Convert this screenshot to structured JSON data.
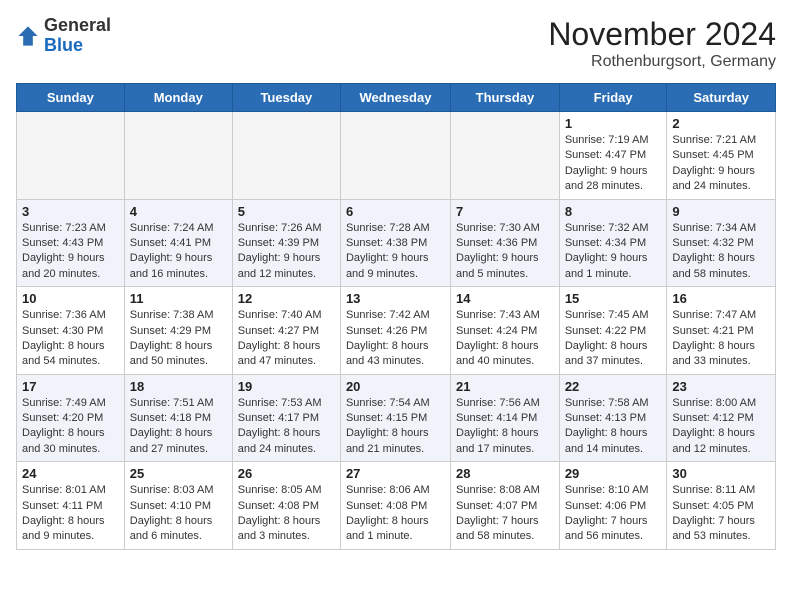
{
  "logo": {
    "general": "General",
    "blue": "Blue"
  },
  "title": {
    "month": "November 2024",
    "location": "Rothenburgsort, Germany"
  },
  "days_of_week": [
    "Sunday",
    "Monday",
    "Tuesday",
    "Wednesday",
    "Thursday",
    "Friday",
    "Saturday"
  ],
  "weeks": [
    [
      {
        "day": "",
        "info": ""
      },
      {
        "day": "",
        "info": ""
      },
      {
        "day": "",
        "info": ""
      },
      {
        "day": "",
        "info": ""
      },
      {
        "day": "",
        "info": ""
      },
      {
        "day": "1",
        "info": "Sunrise: 7:19 AM\nSunset: 4:47 PM\nDaylight: 9 hours and 28 minutes."
      },
      {
        "day": "2",
        "info": "Sunrise: 7:21 AM\nSunset: 4:45 PM\nDaylight: 9 hours and 24 minutes."
      }
    ],
    [
      {
        "day": "3",
        "info": "Sunrise: 7:23 AM\nSunset: 4:43 PM\nDaylight: 9 hours and 20 minutes."
      },
      {
        "day": "4",
        "info": "Sunrise: 7:24 AM\nSunset: 4:41 PM\nDaylight: 9 hours and 16 minutes."
      },
      {
        "day": "5",
        "info": "Sunrise: 7:26 AM\nSunset: 4:39 PM\nDaylight: 9 hours and 12 minutes."
      },
      {
        "day": "6",
        "info": "Sunrise: 7:28 AM\nSunset: 4:38 PM\nDaylight: 9 hours and 9 minutes."
      },
      {
        "day": "7",
        "info": "Sunrise: 7:30 AM\nSunset: 4:36 PM\nDaylight: 9 hours and 5 minutes."
      },
      {
        "day": "8",
        "info": "Sunrise: 7:32 AM\nSunset: 4:34 PM\nDaylight: 9 hours and 1 minute."
      },
      {
        "day": "9",
        "info": "Sunrise: 7:34 AM\nSunset: 4:32 PM\nDaylight: 8 hours and 58 minutes."
      }
    ],
    [
      {
        "day": "10",
        "info": "Sunrise: 7:36 AM\nSunset: 4:30 PM\nDaylight: 8 hours and 54 minutes."
      },
      {
        "day": "11",
        "info": "Sunrise: 7:38 AM\nSunset: 4:29 PM\nDaylight: 8 hours and 50 minutes."
      },
      {
        "day": "12",
        "info": "Sunrise: 7:40 AM\nSunset: 4:27 PM\nDaylight: 8 hours and 47 minutes."
      },
      {
        "day": "13",
        "info": "Sunrise: 7:42 AM\nSunset: 4:26 PM\nDaylight: 8 hours and 43 minutes."
      },
      {
        "day": "14",
        "info": "Sunrise: 7:43 AM\nSunset: 4:24 PM\nDaylight: 8 hours and 40 minutes."
      },
      {
        "day": "15",
        "info": "Sunrise: 7:45 AM\nSunset: 4:22 PM\nDaylight: 8 hours and 37 minutes."
      },
      {
        "day": "16",
        "info": "Sunrise: 7:47 AM\nSunset: 4:21 PM\nDaylight: 8 hours and 33 minutes."
      }
    ],
    [
      {
        "day": "17",
        "info": "Sunrise: 7:49 AM\nSunset: 4:20 PM\nDaylight: 8 hours and 30 minutes."
      },
      {
        "day": "18",
        "info": "Sunrise: 7:51 AM\nSunset: 4:18 PM\nDaylight: 8 hours and 27 minutes."
      },
      {
        "day": "19",
        "info": "Sunrise: 7:53 AM\nSunset: 4:17 PM\nDaylight: 8 hours and 24 minutes."
      },
      {
        "day": "20",
        "info": "Sunrise: 7:54 AM\nSunset: 4:15 PM\nDaylight: 8 hours and 21 minutes."
      },
      {
        "day": "21",
        "info": "Sunrise: 7:56 AM\nSunset: 4:14 PM\nDaylight: 8 hours and 17 minutes."
      },
      {
        "day": "22",
        "info": "Sunrise: 7:58 AM\nSunset: 4:13 PM\nDaylight: 8 hours and 14 minutes."
      },
      {
        "day": "23",
        "info": "Sunrise: 8:00 AM\nSunset: 4:12 PM\nDaylight: 8 hours and 12 minutes."
      }
    ],
    [
      {
        "day": "24",
        "info": "Sunrise: 8:01 AM\nSunset: 4:11 PM\nDaylight: 8 hours and 9 minutes."
      },
      {
        "day": "25",
        "info": "Sunrise: 8:03 AM\nSunset: 4:10 PM\nDaylight: 8 hours and 6 minutes."
      },
      {
        "day": "26",
        "info": "Sunrise: 8:05 AM\nSunset: 4:08 PM\nDaylight: 8 hours and 3 minutes."
      },
      {
        "day": "27",
        "info": "Sunrise: 8:06 AM\nSunset: 4:08 PM\nDaylight: 8 hours and 1 minute."
      },
      {
        "day": "28",
        "info": "Sunrise: 8:08 AM\nSunset: 4:07 PM\nDaylight: 7 hours and 58 minutes."
      },
      {
        "day": "29",
        "info": "Sunrise: 8:10 AM\nSunset: 4:06 PM\nDaylight: 7 hours and 56 minutes."
      },
      {
        "day": "30",
        "info": "Sunrise: 8:11 AM\nSunset: 4:05 PM\nDaylight: 7 hours and 53 minutes."
      }
    ]
  ]
}
